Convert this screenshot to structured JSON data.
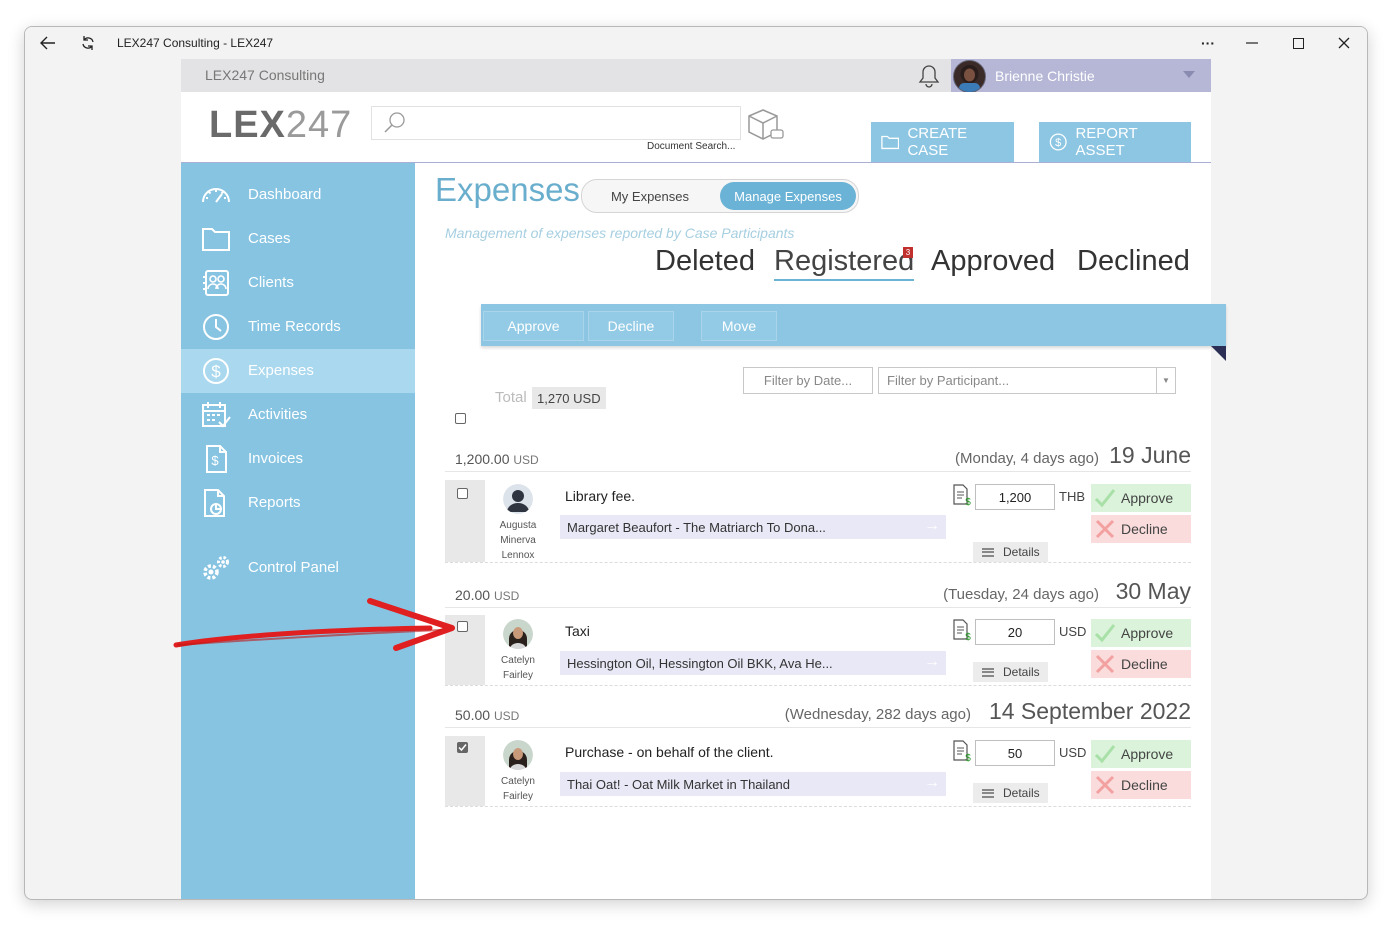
{
  "window": {
    "title": "LEX247 Consulting - LEX247",
    "controls": {
      "more": "···"
    }
  },
  "topbar": {
    "firm_name": "LEX247 Consulting",
    "user_name": "Brienne Christie"
  },
  "header": {
    "logo_bold": "LEX",
    "logo_light": "247",
    "search_caption": "Document Search...",
    "create_case_label": "CREATE CASE",
    "report_asset_label": "REPORT ASSET"
  },
  "sidebar": {
    "items": [
      {
        "label": "Dashboard",
        "icon": "gauge-icon"
      },
      {
        "label": "Cases",
        "icon": "folder-icon"
      },
      {
        "label": "Clients",
        "icon": "contacts-icon"
      },
      {
        "label": "Time Records",
        "icon": "clock-icon"
      },
      {
        "label": "Expenses",
        "icon": "dollar-circle-icon",
        "active": true
      },
      {
        "label": "Activities",
        "icon": "calendar-check-icon"
      },
      {
        "label": "Invoices",
        "icon": "invoice-icon"
      },
      {
        "label": "Reports",
        "icon": "report-icon"
      }
    ],
    "control_panel": "Control Panel"
  },
  "page": {
    "title": "Expenses",
    "toggle": {
      "my": "My Expenses",
      "manage": "Manage Expenses"
    },
    "subtitle": "Management of expenses reported by Case Participants",
    "tabs": [
      "Deleted",
      "Registered",
      "Approved",
      "Declined"
    ],
    "selected_tab": "Registered",
    "registered_badge": "3",
    "actions": {
      "approve": "Approve",
      "decline": "Decline",
      "move": "Move"
    },
    "filters": {
      "date": "Filter by Date...",
      "participant": "Filter by Participant..."
    },
    "total_label": "Total",
    "total_value": "1,270 USD"
  },
  "groups": [
    {
      "amount": "1,200.00",
      "amount_cur": "USD",
      "ago": "(Monday, 4 days ago)",
      "date": "19 June",
      "row": {
        "participant": "Augusta Minerva Lennox",
        "description": "Library fee.",
        "case": "Margaret Beaufort - The Matriarch To Dona...",
        "amount": "1,200",
        "currency": "THB",
        "checked": false
      }
    },
    {
      "amount": "20.00",
      "amount_cur": "USD",
      "ago": "(Tuesday, 24 days ago)",
      "date": "30 May",
      "row": {
        "participant": "Catelyn Fairley",
        "description": "Taxi",
        "case": "Hessington Oil, Hessington Oil BKK, Ava He...",
        "amount": "20",
        "currency": "USD",
        "checked": false
      }
    },
    {
      "amount": "50.00",
      "amount_cur": "USD",
      "ago": "(Wednesday, 282 days ago)",
      "date": "14 September 2022",
      "row": {
        "participant": "Catelyn Fairley",
        "description": "Purchase - on behalf of the client.",
        "case": "Thai Oat! - Oat Milk Market in Thailand",
        "amount": "50",
        "currency": "USD",
        "checked": true
      }
    }
  ],
  "row_labels": {
    "approve": "Approve",
    "decline": "Decline",
    "details": "Details"
  },
  "annotation": {
    "arrow_color": "#e02020",
    "arrow_target": "taxi-row-checkbox"
  },
  "colors": {
    "sidebar": "#87c4e2",
    "sidebar_active": "#aad8ee",
    "accent": "#6ab3d6",
    "approve_bg": "#daf3da",
    "decline_bg": "#fadcdc"
  }
}
